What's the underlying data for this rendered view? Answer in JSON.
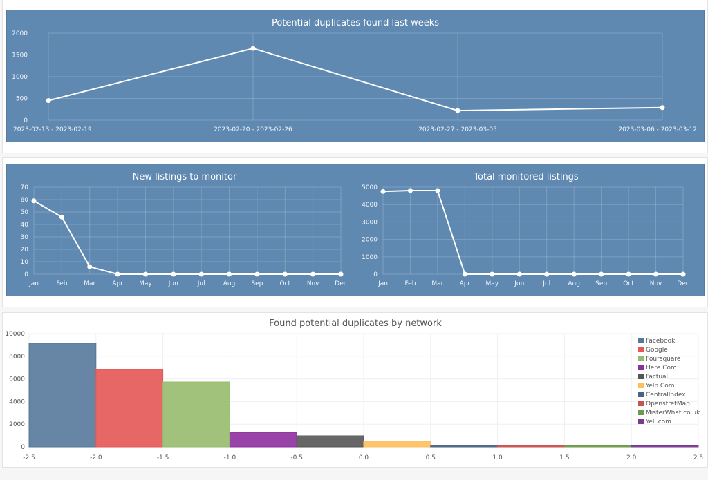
{
  "colors": {
    "panel_bg": "#6089b2",
    "line": "#ffffff",
    "grid_light": "rgba(255,255,255,0.18)"
  },
  "chart_data": [
    {
      "id": "weekly-duplicates",
      "type": "line",
      "title": "Potential duplicates found last weeks",
      "categories": [
        "2023-02-13 - 2023-02-19",
        "2023-02-20 - 2023-02-26",
        "2023-02-27 - 2023-03-05",
        "2023-03-06 - 2023-03-12"
      ],
      "values": [
        450,
        1650,
        220,
        290
      ],
      "yticks": [
        0,
        500,
        1000,
        1500,
        2000
      ],
      "ylim": [
        0,
        2000
      ],
      "xlabel": "",
      "ylabel": "",
      "grid": true
    },
    {
      "id": "new-listings",
      "type": "line",
      "title": "New listings to monitor",
      "categories": [
        "Jan",
        "Feb",
        "Mar",
        "Apr",
        "May",
        "Jun",
        "Jul",
        "Aug",
        "Sep",
        "Oct",
        "Nov",
        "Dec"
      ],
      "values": [
        59,
        46,
        6,
        0,
        0,
        0,
        0,
        0,
        0,
        0,
        0,
        0
      ],
      "yticks": [
        0,
        10,
        20,
        30,
        40,
        50,
        60,
        70
      ],
      "ylim": [
        0,
        70
      ],
      "xlabel": "",
      "ylabel": "",
      "grid": true
    },
    {
      "id": "total-monitored",
      "type": "line",
      "title": "Total monitored listings",
      "categories": [
        "Jan",
        "Feb",
        "Mar",
        "Apr",
        "May",
        "Jun",
        "Jul",
        "Aug",
        "Sep",
        "Oct",
        "Nov",
        "Dec"
      ],
      "values": [
        4750,
        4800,
        4800,
        0,
        0,
        0,
        0,
        0,
        0,
        0,
        0,
        0
      ],
      "yticks": [
        0,
        1000,
        2000,
        3000,
        4000,
        5000
      ],
      "ylim": [
        0,
        5000
      ],
      "xlabel": "",
      "ylabel": "",
      "grid": true
    },
    {
      "id": "by-network",
      "type": "bar",
      "title": "Found potential duplicates by network",
      "series": [
        {
          "name": "Facebook",
          "value": 9150,
          "color": "#56789a"
        },
        {
          "name": "Google",
          "value": 6830,
          "color": "#e45757"
        },
        {
          "name": "Foursquare",
          "value": 5730,
          "color": "#96bb6c"
        },
        {
          "name": "Here Com",
          "value": 1280,
          "color": "#8e2fa0"
        },
        {
          "name": "Factual",
          "value": 975,
          "color": "#555555"
        },
        {
          "name": "Yelp Com",
          "value": 490,
          "color": "#fdbf5e"
        },
        {
          "name": "CentralIndex",
          "value": 120,
          "color": "#4a6381"
        },
        {
          "name": "OpenstretMap",
          "value": 80,
          "color": "#c9544f"
        },
        {
          "name": "MisterWhat.co.uk",
          "value": 70,
          "color": "#6f9a4b"
        },
        {
          "name": "Yell.com",
          "value": 50,
          "color": "#7a3a90"
        }
      ],
      "xticks": [
        "-2.5",
        "-2.0",
        "-1.5",
        "-1.0",
        "-0.5",
        "0.0",
        "0.5",
        "1.0",
        "1.5",
        "2.0",
        "2.5"
      ],
      "xlim": [
        -2.5,
        2.5
      ],
      "yticks": [
        0,
        2000,
        4000,
        6000,
        8000,
        10000
      ],
      "ylim": [
        0,
        10000
      ],
      "legend": "top-right",
      "grid": true
    }
  ]
}
